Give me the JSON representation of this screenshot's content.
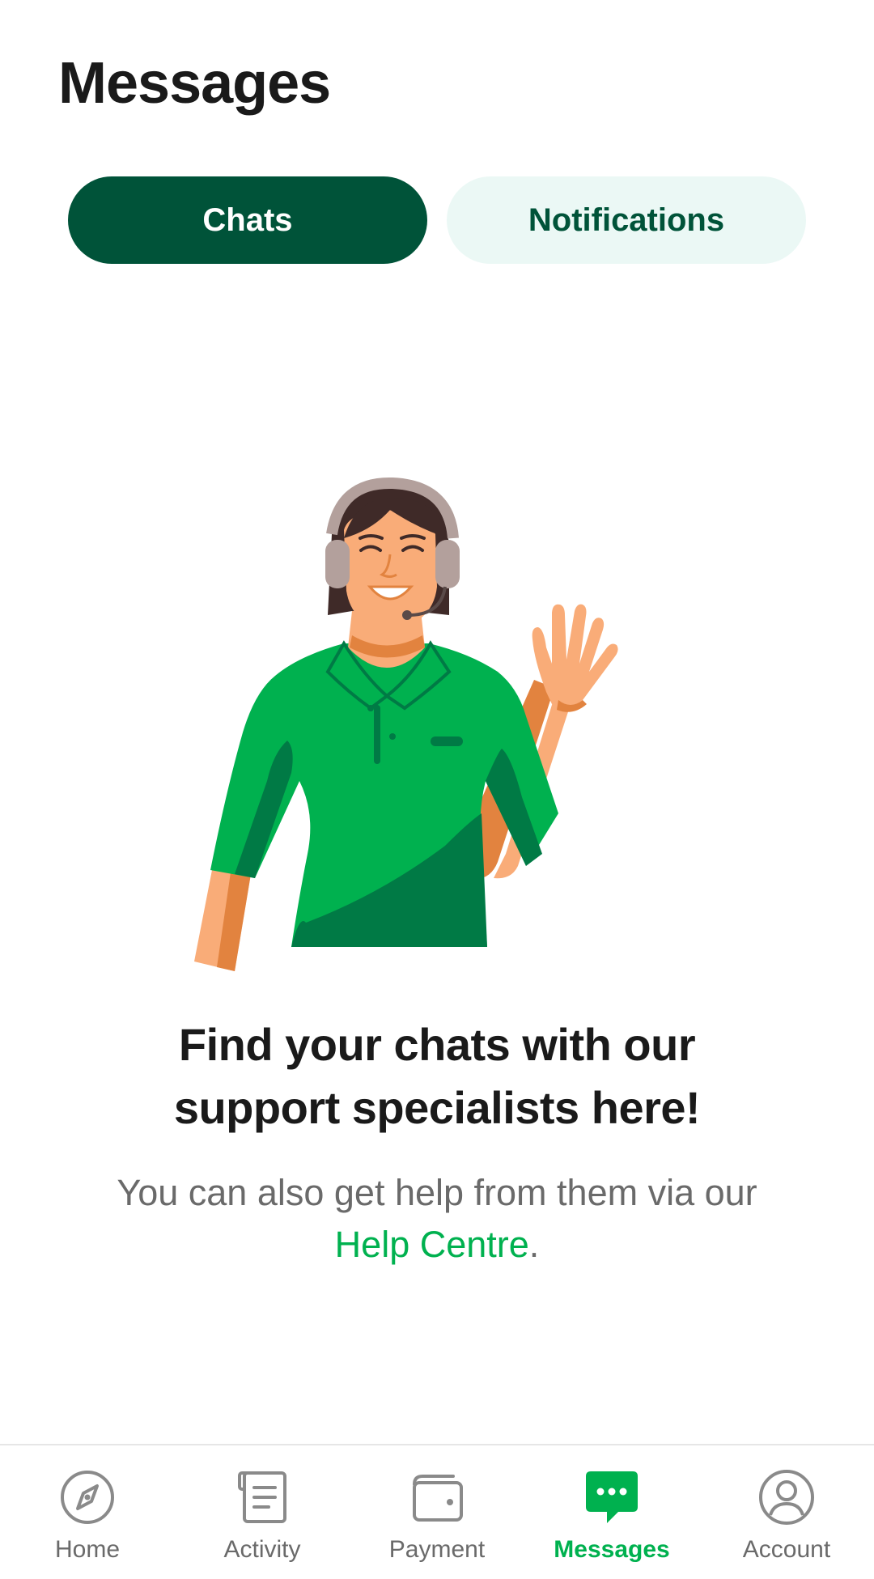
{
  "header": {
    "title": "Messages"
  },
  "tabs": [
    {
      "label": "Chats",
      "active": true
    },
    {
      "label": "Notifications",
      "active": false
    }
  ],
  "empty_state": {
    "headline_line1": "Find your chats with our",
    "headline_line2": "support specialists here!",
    "subtext_line1": "You can also get help from them via our",
    "help_link": "Help Centre",
    "help_suffix": "."
  },
  "bottom_nav": {
    "items": [
      {
        "label": "Home",
        "icon": "compass-icon",
        "active": false
      },
      {
        "label": "Activity",
        "icon": "document-list-icon",
        "active": false
      },
      {
        "label": "Payment",
        "icon": "wallet-icon",
        "active": false
      },
      {
        "label": "Messages",
        "icon": "chat-bubble-icon",
        "active": true
      },
      {
        "label": "Account",
        "icon": "user-circle-icon",
        "active": false
      }
    ]
  },
  "colors": {
    "brand_green": "#00b14f",
    "dark_green": "#005339",
    "tab_inactive_bg": "#ebf8f5",
    "muted_text": "#6a6a6a"
  }
}
